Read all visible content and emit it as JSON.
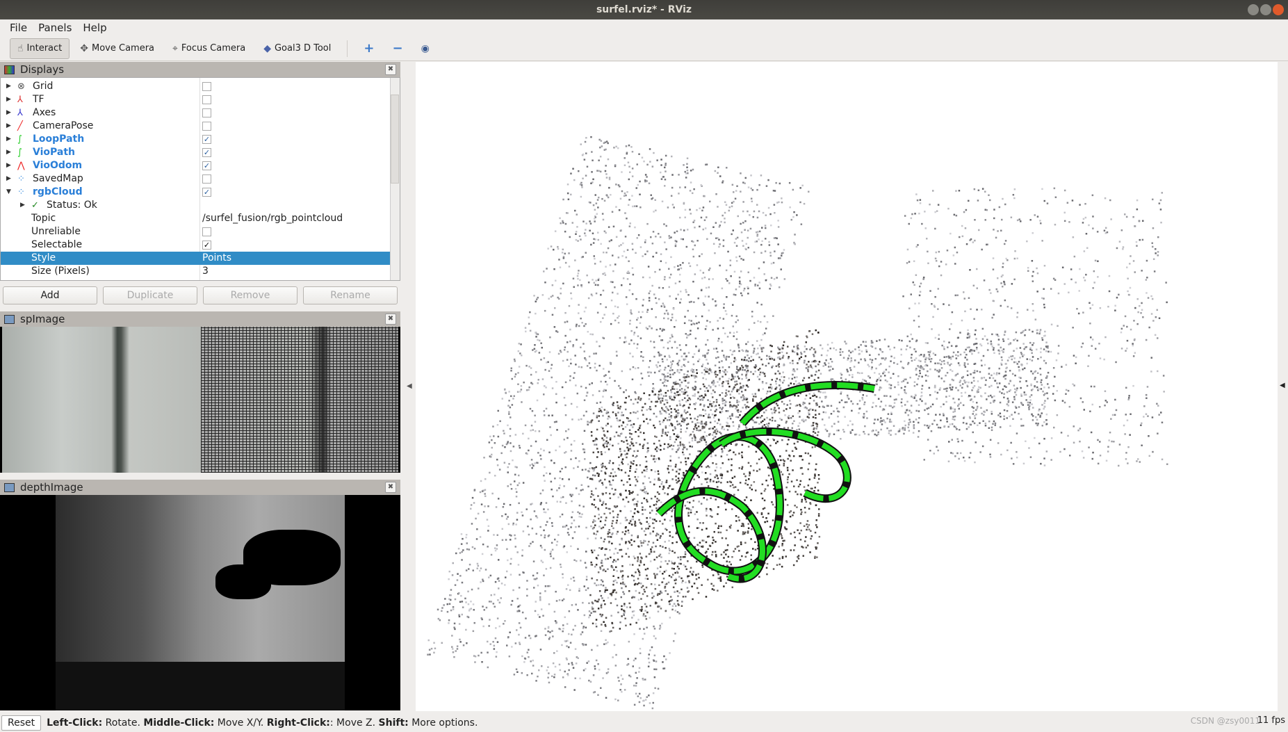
{
  "window": {
    "title": "surfel.rviz* - RViz"
  },
  "menu": [
    "File",
    "Panels",
    "Help"
  ],
  "toolbar": {
    "tools": [
      {
        "label": "Interact",
        "icon": "hand-icon",
        "active": true
      },
      {
        "label": "Move Camera",
        "icon": "move-camera-icon"
      },
      {
        "label": "Focus Camera",
        "icon": "focus-camera-icon"
      },
      {
        "label": "Goal3 D Tool",
        "icon": "goal-diamond-icon"
      }
    ],
    "extra_icons": [
      "plus-icon",
      "minus-icon",
      "eye-icon"
    ]
  },
  "displays": {
    "title": "Displays",
    "items": [
      {
        "label": "Grid",
        "icon": "grid-icon",
        "checked": false
      },
      {
        "label": "TF",
        "icon": "tf-icon",
        "checked": false
      },
      {
        "label": "Axes",
        "icon": "axes-icon",
        "checked": false
      },
      {
        "label": "CameraPose",
        "icon": "pose-icon",
        "checked": false
      },
      {
        "label": "LoopPath",
        "icon": "path-icon",
        "checked": true
      },
      {
        "label": "VioPath",
        "icon": "path-icon",
        "checked": true
      },
      {
        "label": "VioOdom",
        "icon": "odometry-icon",
        "checked": true
      },
      {
        "label": "SavedMap",
        "icon": "pointcloud-icon",
        "checked": false
      },
      {
        "label": "rgbCloud",
        "icon": "pointcloud-icon",
        "checked": true,
        "expanded": true
      }
    ],
    "props": [
      {
        "label": "Status: Ok"
      },
      {
        "label": "Topic",
        "value": "/surfel_fusion/rgb_pointcloud"
      },
      {
        "label": "Unreliable",
        "checked": false
      },
      {
        "label": "Selectable",
        "checked": true
      },
      {
        "label": "Style",
        "value": "Points",
        "selected": true
      },
      {
        "label": "Size (Pixels)",
        "value": "3"
      }
    ],
    "buttons": {
      "add": "Add",
      "duplicate": "Duplicate",
      "remove": "Remove",
      "rename": "Rename"
    }
  },
  "panels": {
    "spimage": "spImage",
    "depthimage": "depthImage"
  },
  "status": {
    "reset": "Reset",
    "l1": "Left-Click:",
    "t1": " Rotate. ",
    "l2": "Middle-Click:",
    "t2": " Move X/Y. ",
    "l3": "Right-Click:",
    "t3": ": Move Z. ",
    "l4": "Shift:",
    "t4": " More options.",
    "fps": "11 fps",
    "watermark": "CSDN @zsy0011"
  },
  "colors": {
    "selection": "#308cc6",
    "path": "#22dd22",
    "enabled_label": "#2a7fd8"
  }
}
